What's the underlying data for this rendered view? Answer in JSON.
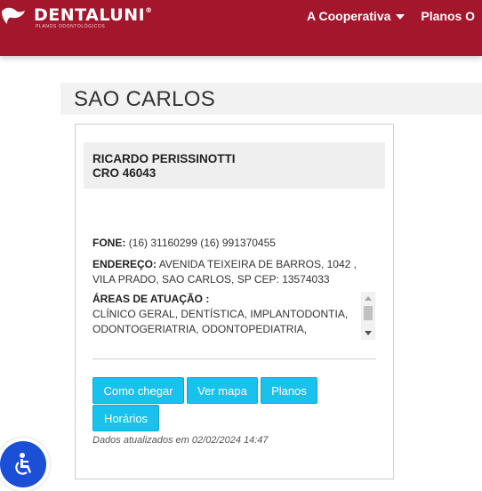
{
  "header": {
    "logo_text": "DENTALUNI",
    "logo_reg": "®",
    "logo_sub": "PLANOS ODONTOLÓGICOS",
    "nav": [
      {
        "label": "A Cooperativa"
      },
      {
        "label": "Planos O"
      }
    ],
    "colors": {
      "brand": "#a3162c"
    }
  },
  "page": {
    "city": "SAO CARLOS"
  },
  "dentist": {
    "name": "RICARDO PERISSINOTTI",
    "cro": "CRO 46043",
    "fone_label": "FONE:",
    "fone_value": "(16) 31160299 (16) 991370455",
    "endereco_label": "ENDEREÇO:",
    "endereco_value": "AVENIDA TEIXEIRA DE BARROS, 1042 , VILA PRADO, SAO CARLOS, SP CEP: 13574033",
    "areas_label": "ÁREAS DE ATUAÇÃO :",
    "areas_value": "CLÍNICO GERAL, DENTÍSTICA, IMPLANTODONTIA, ODONTOGERIATRIA, ODONTOPEDIATRIA,"
  },
  "actions": {
    "como_chegar": "Como chegar",
    "ver_mapa": "Ver mapa",
    "planos": "Planos",
    "horarios": "Horários",
    "accent": "#18c2ec"
  },
  "footer_note": "Dados atualizados em 02/02/2024 14:47",
  "widgets": {
    "accessibility_icon": "accessibility-icon"
  }
}
